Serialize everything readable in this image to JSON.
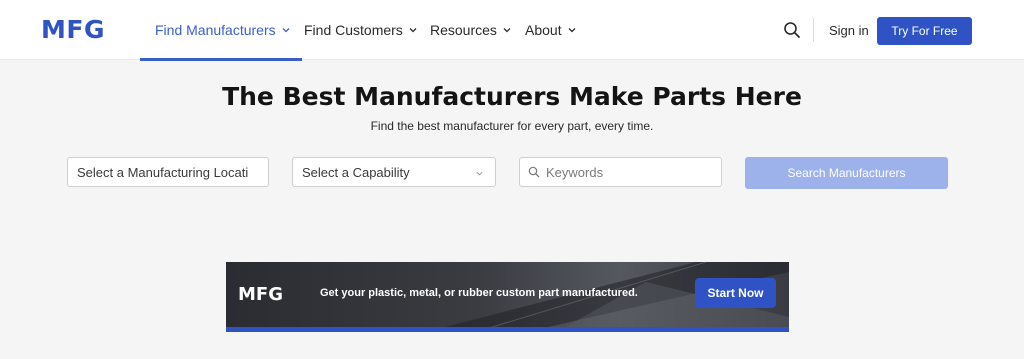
{
  "brand": {
    "logo_text": "MFG",
    "accent_color": "#2f52c4"
  },
  "nav": {
    "items": [
      {
        "label": "Find Manufacturers",
        "active": true
      },
      {
        "label": "Find Customers",
        "active": false
      },
      {
        "label": "Resources",
        "active": false
      },
      {
        "label": "About",
        "active": false
      }
    ],
    "search_icon": "search-icon",
    "sign_in_label": "Sign in",
    "try_label": "Try For Free"
  },
  "hero": {
    "title": "The Best Manufacturers Make Parts Here",
    "subtitle": "Find the best manufacturer for every part, every time."
  },
  "search": {
    "location_value": "Select a Manufacturing Locati",
    "capability_value": "Select a Capability",
    "keywords_placeholder": "Keywords",
    "button_label": "Search Manufacturers",
    "button_color": "#9db1ea"
  },
  "banner": {
    "logo_text": "MFG",
    "text": "Get your plastic, metal, or rubber custom part manufactured.",
    "button_label": "Start Now"
  }
}
